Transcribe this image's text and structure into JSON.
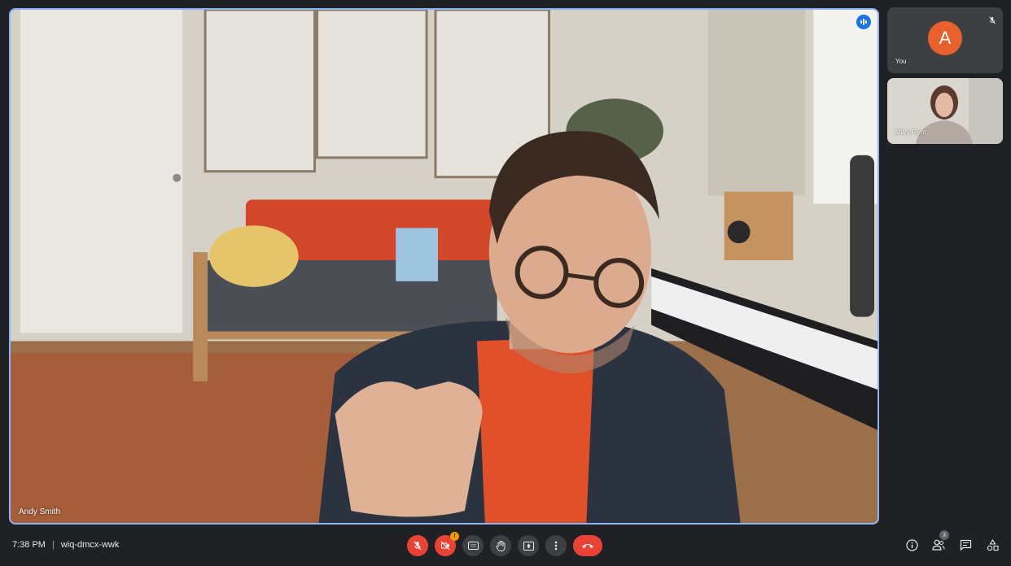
{
  "main_tile": {
    "participant_name": "Andy Smith",
    "speaking": true
  },
  "side_tiles": [
    {
      "label": "You",
      "avatar_letter": "A",
      "avatar_color": "#e8602c",
      "muted": true
    },
    {
      "label": "Mary Flynt",
      "muted": false
    }
  ],
  "bottom_bar": {
    "time": "7:38 PM",
    "separator": "|",
    "meeting_code": "wiq-dmcx-wwk",
    "controls": [
      {
        "name": "microphone-off",
        "state": "off"
      },
      {
        "name": "camera-off",
        "state": "off",
        "alert": "!"
      },
      {
        "name": "captions"
      },
      {
        "name": "raise-hand"
      },
      {
        "name": "present-screen"
      },
      {
        "name": "more-options"
      },
      {
        "name": "leave-call"
      }
    ],
    "people_count": "3"
  },
  "colors": {
    "accent": "#8ab4f8",
    "danger": "#ea4335",
    "background": "#202124",
    "warning": "#f29900"
  }
}
